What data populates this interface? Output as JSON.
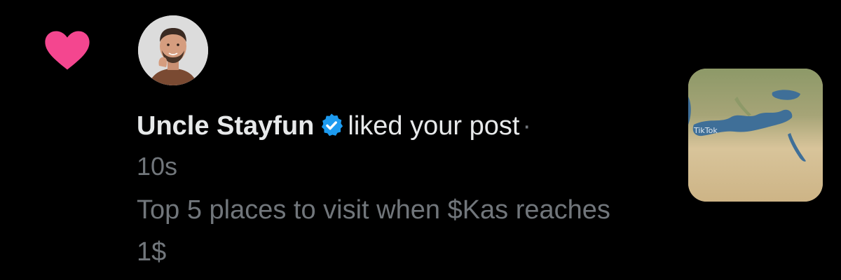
{
  "notification": {
    "icons": {
      "like": "heart-icon",
      "verified": "verified-badge-icon"
    },
    "colors": {
      "heart": "#f4468f",
      "verified": "#1d9bf0",
      "primary_text": "#e7e9ea",
      "secondary_text": "#71767b",
      "background": "#000000"
    },
    "user_name": "Uncle Stayfun",
    "action": "liked your post",
    "separator": "·",
    "time_ago": "10s",
    "post_text": "Top 5 places to visit when $Kas reaches 1$",
    "thumbnail": {
      "watermark": "TikTok"
    }
  }
}
